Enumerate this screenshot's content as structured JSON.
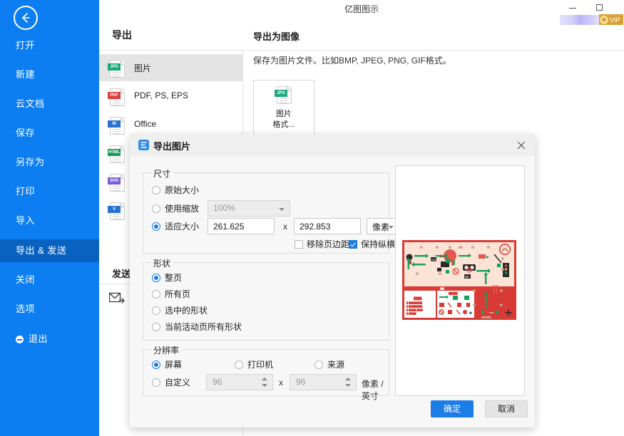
{
  "window": {
    "app_title": "亿图图示",
    "minimize_icon": "minimize-icon",
    "maximize_icon": "maximize-icon",
    "vip_label": "VIP"
  },
  "sidebar": {
    "back_icon": "back-arrow-icon",
    "items": [
      {
        "label": "打开",
        "active": false
      },
      {
        "label": "新建",
        "active": false
      },
      {
        "label": "云文档",
        "active": false
      },
      {
        "label": "保存",
        "active": false
      },
      {
        "label": "另存为",
        "active": false
      },
      {
        "label": "打印",
        "active": false
      },
      {
        "label": "导入",
        "active": false
      },
      {
        "label": "导出 & 发送",
        "active": true
      },
      {
        "label": "关闭",
        "active": false
      },
      {
        "label": "选项",
        "active": false
      },
      {
        "label": "退出",
        "active": false
      }
    ],
    "accent_color": "#0c7ef2",
    "active_color": "#0a62c0"
  },
  "export_panel": {
    "heading": "导出",
    "formats": [
      {
        "label": "图片",
        "tag": "JPG",
        "color": "#1aa87c",
        "selected": true
      },
      {
        "label": "PDF, PS, EPS",
        "tag": "PDF",
        "color": "#e03a3a",
        "selected": false
      },
      {
        "label": "Office",
        "tag": "W",
        "color": "#2b72d0",
        "selected": false
      },
      {
        "label": "",
        "tag": "HTML",
        "color": "#179a55",
        "selected": false
      },
      {
        "label": "",
        "tag": "SVG",
        "color": "#7a5bd6",
        "selected": false
      },
      {
        "label": "",
        "tag": "V",
        "color": "#2b72d0",
        "selected": false
      }
    ],
    "send_heading": "发送",
    "send_mail_icon": "mail-send-icon"
  },
  "detail_panel": {
    "heading": "导出为图像",
    "description": "保存为图片文件。比如BMP, JPEG, PNG, GIF格式。",
    "tile": {
      "tag": "JPG",
      "color": "#1aa87c",
      "line1": "图片",
      "line2": "格式..."
    }
  },
  "dialog": {
    "app_icon": "export-image-icon",
    "title": "导出图片",
    "close_icon": "close-icon",
    "size_group": {
      "title": "尺寸",
      "option_original": "原始大小",
      "option_scale": "使用缩放",
      "option_fit": "适应大小",
      "selected": "适应大小",
      "scale_value": "100%",
      "width_value": "261.625",
      "height_value": "292.853",
      "multiply_symbol": "x",
      "unit_value": "像素",
      "checkbox_remove_margin": "移除页边距",
      "checkbox_remove_margin_checked": false,
      "checkbox_keep_ratio": "保持纵横比",
      "checkbox_keep_ratio_checked": true
    },
    "shape_group": {
      "title": "形状",
      "options": [
        "整页",
        "所有页",
        "选中的形状",
        "当前活动页所有形状"
      ],
      "selected": "整页"
    },
    "resolution_group": {
      "title": "分辨率",
      "options": [
        "屏幕",
        "打印机",
        "来源",
        "自定义"
      ],
      "selected": "屏幕",
      "dpi_x": "96",
      "dpi_y": "96",
      "multiply_symbol": "x",
      "unit_label": "像素 / 英寸"
    },
    "preview": {
      "name": "export-preview",
      "border_color": "#d8d8d8"
    },
    "buttons": {
      "ok": "确定",
      "cancel": "取消"
    }
  }
}
